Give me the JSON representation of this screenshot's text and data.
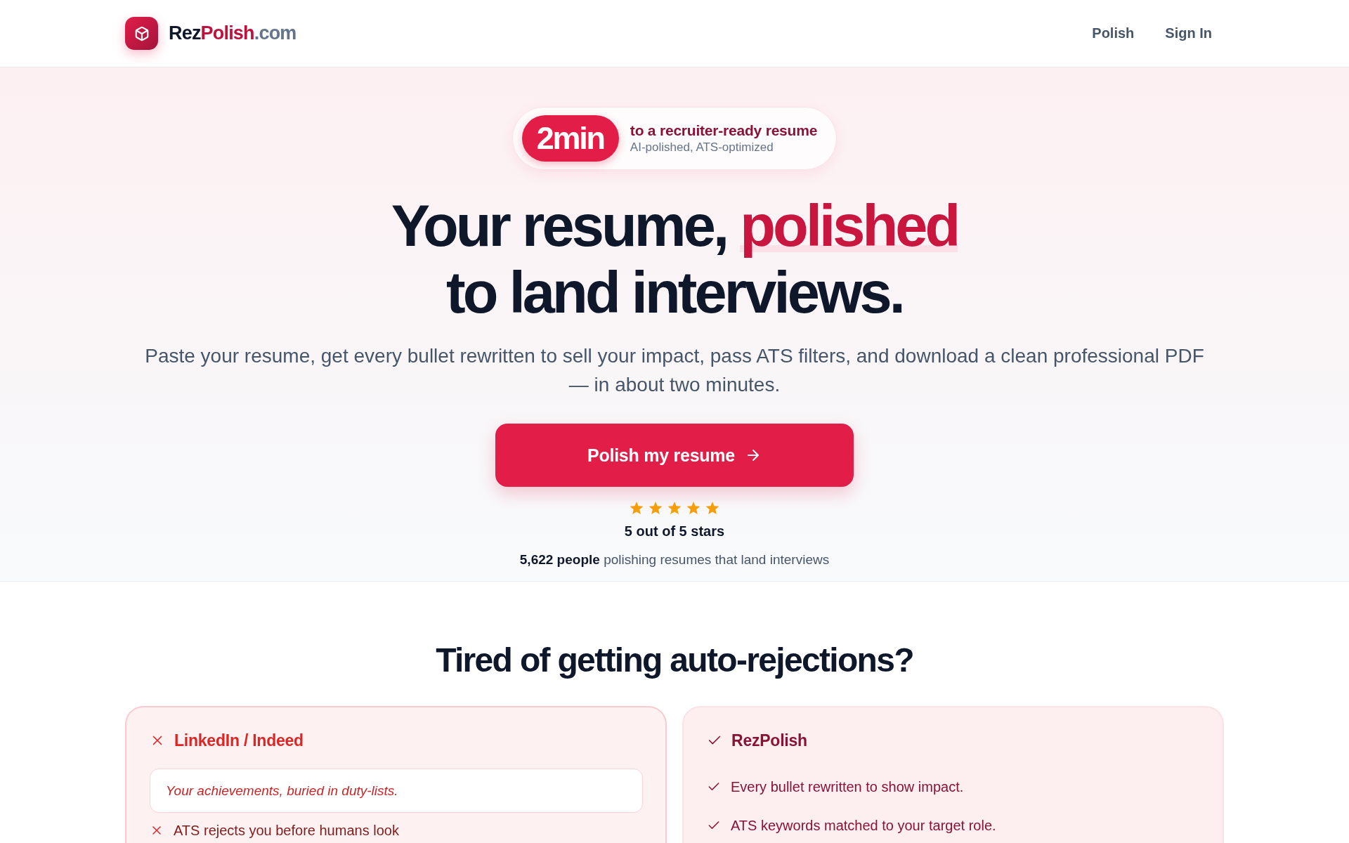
{
  "header": {
    "logo": {
      "name": "Rez",
      "accent": "Polish",
      "suffix": ".com"
    },
    "nav": [
      {
        "label": "Polish"
      },
      {
        "label": "Sign In"
      }
    ]
  },
  "hero": {
    "badge": {
      "value": "2min",
      "title": "to a recruiter-ready resume",
      "subtitle": "AI-polished, ATS-optimized"
    },
    "headline": {
      "before": "Your resume,",
      "highlight": "polished",
      "after": "to land interviews."
    },
    "subtitle": "Paste your resume, get every bullet rewritten to sell your impact, pass ATS filters, and download a clean professional PDF — in about two minutes.",
    "cta": {
      "label": "Polish my resume"
    },
    "rating": {
      "stars": 5,
      "label": "5 out of 5 stars"
    },
    "social_proof": "**5,622 people** polishing resumes that land interviews"
  },
  "comparison": {
    "title": "Tired of getting auto-rejections?",
    "cards": [
      {
        "kind": "bad",
        "title": "LinkedIn / Indeed",
        "quote": "Your achievements, buried in duty-lists.",
        "items": [
          "ATS rejects you before humans look"
        ]
      },
      {
        "kind": "good",
        "title": "RezPolish",
        "items": [
          "Every bullet rewritten to show impact.",
          "ATS keywords matched to your target role."
        ]
      }
    ]
  }
}
